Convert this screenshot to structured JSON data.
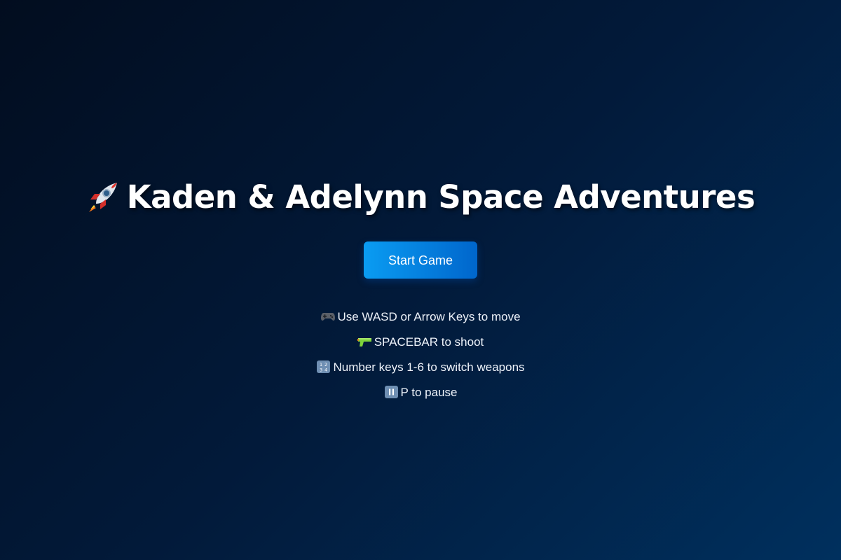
{
  "menu": {
    "title": "Kaden & Adelynn Space Adventures",
    "title_icon": "rocket-icon",
    "start_button": "Start Game",
    "instructions": [
      {
        "icon": "gamepad-icon",
        "text": "Use WASD or Arrow Keys to move"
      },
      {
        "icon": "water-pistol-icon",
        "text": "SPACEBAR to shoot"
      },
      {
        "icon": "number-keys-icon",
        "text": "Number keys 1-6 to switch weapons"
      },
      {
        "icon": "pause-icon",
        "text": "P to pause"
      }
    ]
  },
  "colors": {
    "background_dark": "#020d1f",
    "background_light": "#00305e",
    "button_start": "#0a9cf2",
    "button_end": "#0066cc",
    "text": "#ffffff"
  }
}
